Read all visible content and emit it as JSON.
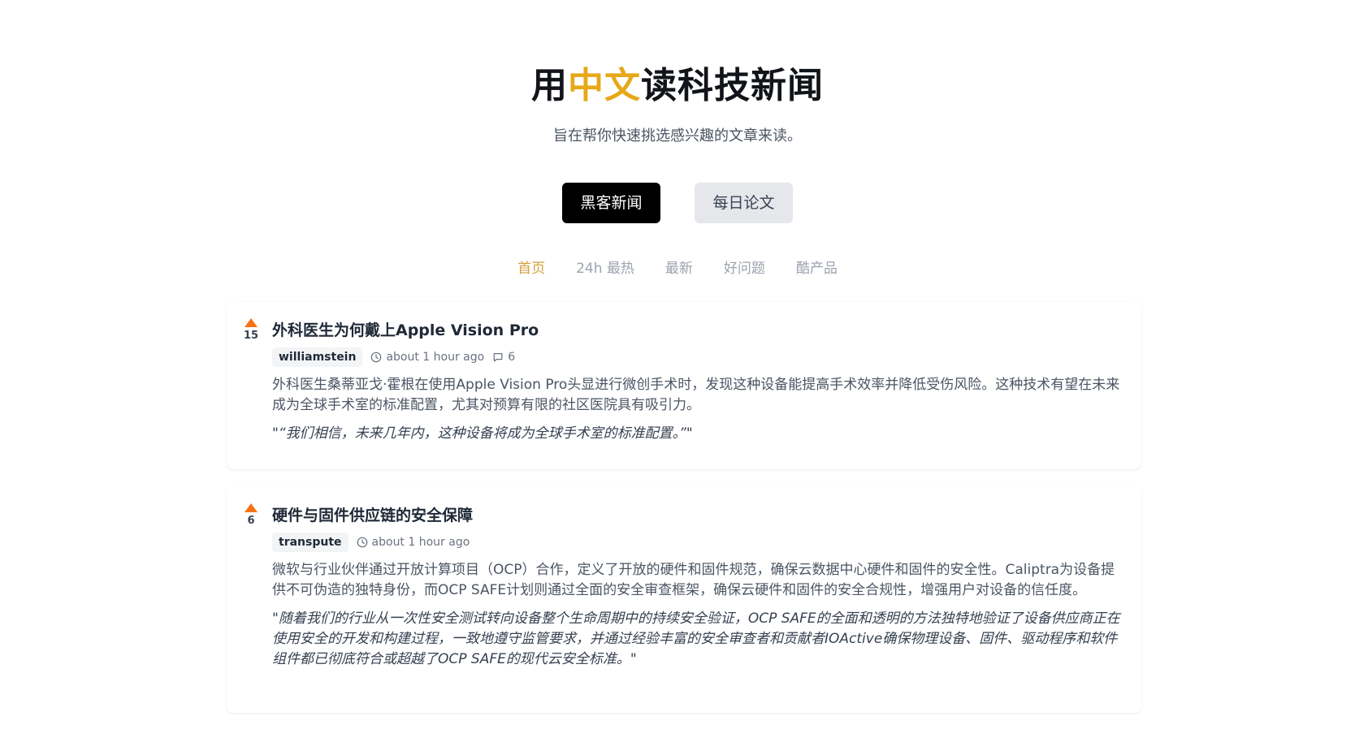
{
  "header": {
    "title_part1": "用",
    "title_accent": "中文",
    "title_part2": "读科技新闻",
    "tagline": "旨在帮你快速挑选感兴趣的文章来读。",
    "accent_color": "#e6a817"
  },
  "switch": {
    "hacker_news": "黑客新闻",
    "daily_papers": "每日论文"
  },
  "nav": {
    "home": "首页",
    "hot24h": "24h 最热",
    "latest": "最新",
    "good_questions": "好问题",
    "cool_products": "酷产品"
  },
  "posts": [
    {
      "score": "15",
      "title": "外科医生为何戴上Apple Vision Pro",
      "author": "williamstein",
      "time": "about 1 hour ago",
      "comments": "6",
      "summary": "外科医生桑蒂亚戈·霍根在使用Apple Vision Pro头显进行微创手术时，发现这种设备能提高手术效率并降低受伤风险。这种技术有望在未来成为全球手术室的标准配置，尤其对预算有限的社区医院具有吸引力。",
      "quote": "\"“我们相信，未来几年内，这种设备将成为全球手术室的标准配置。”\""
    },
    {
      "score": "6",
      "title": "硬件与固件供应链的安全保障",
      "author": "transpute",
      "time": "about 1 hour ago",
      "summary": "微软与行业伙伴通过开放计算项目（OCP）合作，定义了开放的硬件和固件规范，确保云数据中心硬件和固件的安全性。Caliptra为设备提供不可伪造的独特身份，而OCP SAFE计划则通过全面的安全审查框架，确保云硬件和固件的安全合规性，增强用户对设备的信任度。",
      "quote": "\"随着我们的行业从一次性安全测试转向设备整个生命周期中的持续安全验证，OCP SAFE的全面和透明的方法独特地验证了设备供应商正在使用安全的开发和构建过程，一致地遵守监管要求，并通过经验丰富的安全审查者和贡献者IOActive确保物理设备、固件、驱动程序和软件组件都已彻底符合或超越了OCP SAFE的现代云安全标准。\""
    }
  ]
}
